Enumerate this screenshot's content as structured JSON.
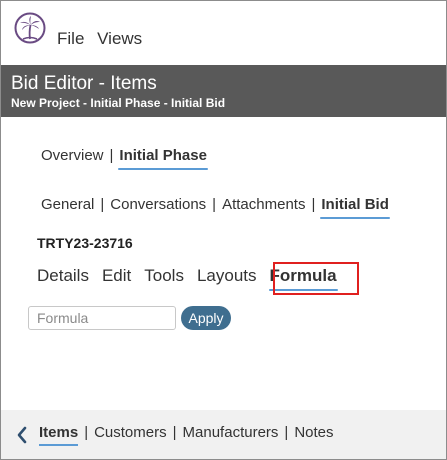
{
  "app": {
    "logo_icon": "palm-tree-logo-icon"
  },
  "menu": {
    "file": "File",
    "views": "Views"
  },
  "header": {
    "title": "Bid Editor - Items",
    "subtitle": "New Project - Initial Phase - Initial Bid",
    "background": "#595959"
  },
  "project_tabs": {
    "overview": "Overview",
    "initial_phase": "Initial Phase",
    "separator": "|"
  },
  "phase_tabs": {
    "general": "General",
    "conversations": "Conversations",
    "attachments": "Attachments",
    "initial_bid": "Initial Bid",
    "separator": "|"
  },
  "bid_code": "TRTY23-23716",
  "item_tabs": {
    "details": "Details",
    "edit": "Edit",
    "tools": "Tools",
    "layouts": "Layouts",
    "formula": "Formula"
  },
  "formula": {
    "placeholder": "Formula",
    "value": "",
    "apply_label": "Apply",
    "apply_color": "#3f6e8f"
  },
  "bottom_nav": {
    "back_icon": "chevron-left-icon",
    "items": "Items",
    "customers": "Customers",
    "manufacturers": "Manufacturers",
    "notes": "Notes",
    "separator": "|"
  },
  "colors": {
    "accent_underline": "#5b9bd5",
    "highlight_box": "#e0201f"
  }
}
